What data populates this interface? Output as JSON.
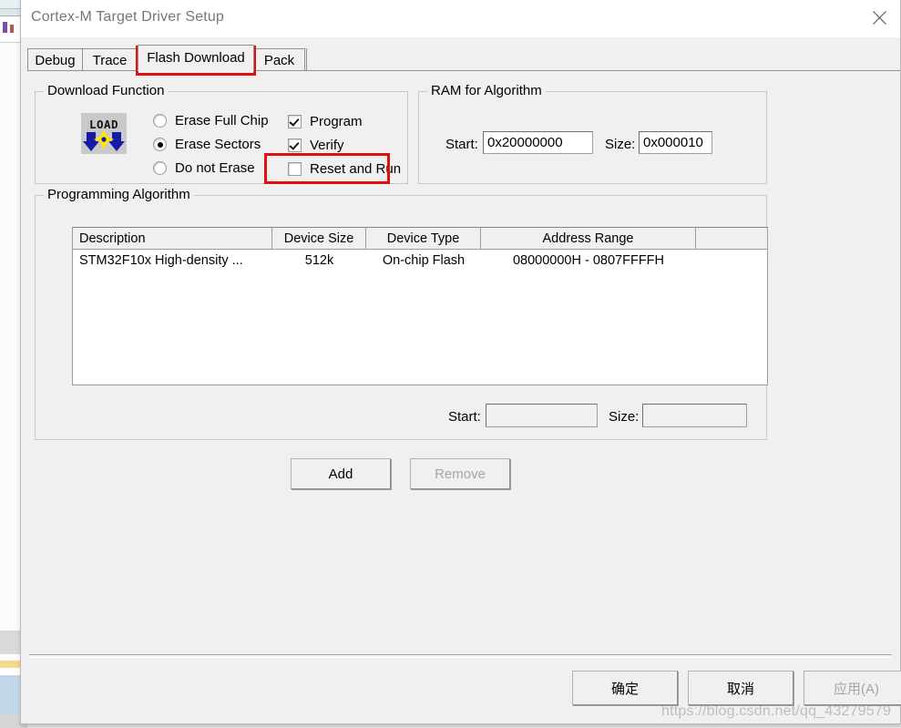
{
  "window": {
    "title": "Cortex-M Target Driver Setup",
    "close_icon": "close-icon"
  },
  "tabs": [
    {
      "label": "Debug",
      "selected": false
    },
    {
      "label": "Trace",
      "selected": false
    },
    {
      "label": "Flash Download",
      "selected": true
    },
    {
      "label": "Pack",
      "selected": false
    }
  ],
  "download_function": {
    "title": "Download Function",
    "icon_label": "LOAD",
    "erase_options": [
      {
        "label": "Erase Full Chip",
        "selected": false
      },
      {
        "label": "Erase Sectors",
        "selected": true
      },
      {
        "label": "Do not Erase",
        "selected": false
      }
    ],
    "checkboxes": [
      {
        "label": "Program",
        "checked": true
      },
      {
        "label": "Verify",
        "checked": true
      },
      {
        "label": "Reset and Run",
        "checked": false
      }
    ]
  },
  "ram_for_algorithm": {
    "title": "RAM for Algorithm",
    "start_label": "Start:",
    "start_value": "0x20000000",
    "size_label": "Size:",
    "size_value": "0x000010"
  },
  "programming_algorithm": {
    "title": "Programming Algorithm",
    "columns": [
      "Description",
      "Device Size",
      "Device Type",
      "Address Range",
      ""
    ],
    "rows": [
      {
        "description": "STM32F10x High-density ...",
        "device_size": "512k",
        "device_type": "On-chip Flash",
        "address_range": "08000000H - 0807FFFFH"
      }
    ],
    "start_label": "Start:",
    "start_value": "",
    "size_label": "Size:",
    "size_value": "",
    "add_label": "Add",
    "remove_label": "Remove"
  },
  "footer": {
    "ok_label": "确定",
    "cancel_label": "取消",
    "apply_label": "应用(A)"
  },
  "watermark": "https://blog.csdn.net/qq_43279579",
  "colors": {
    "annotation": "#e01010",
    "dialog_bg": "#f0f0f0",
    "title_text": "#767676"
  }
}
